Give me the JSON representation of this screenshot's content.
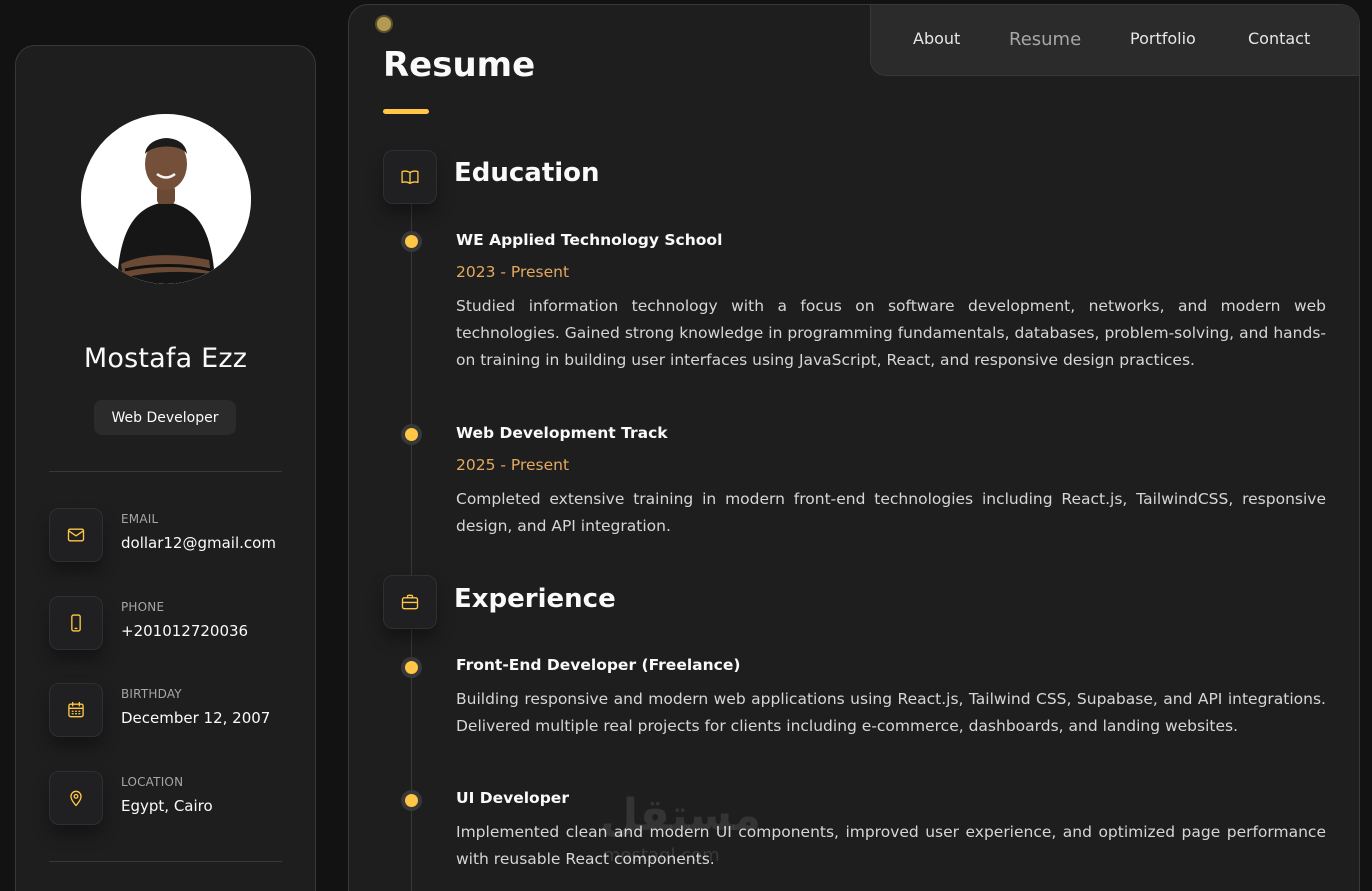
{
  "profile": {
    "name": "Mostafa Ezz",
    "role": "Web Developer"
  },
  "contacts": [
    {
      "label": "EMAIL",
      "value": "dollar12@gmail.com",
      "icon": "mail-icon"
    },
    {
      "label": "PHONE",
      "value": "+201012720036",
      "icon": "phone-icon"
    },
    {
      "label": "BIRTHDAY",
      "value": "December 12, 2007",
      "icon": "calendar-icon"
    },
    {
      "label": "LOCATION",
      "value": "Egypt, Cairo",
      "icon": "location-pin-icon"
    }
  ],
  "nav": {
    "items": [
      "About",
      "Resume",
      "Portfolio",
      "Contact"
    ],
    "active": "Resume"
  },
  "page": {
    "title": "Resume"
  },
  "education": {
    "title": "Education",
    "icon": "book-icon",
    "items": [
      {
        "title": "WE Applied Technology School",
        "date": "2023 - Present",
        "text": "Studied information technology with a focus on software development, networks, and modern web technologies. Gained strong knowledge in programming fundamentals, databases, problem-solving, and hands-on training in building user interfaces using JavaScript, React, and responsive design practices."
      },
      {
        "title": "Web Development Track",
        "date": "2025 - Present",
        "text": "Completed extensive training in modern front-end technologies including React.js, TailwindCSS, responsive design, and API integration."
      }
    ]
  },
  "experience": {
    "title": "Experience",
    "icon": "briefcase-icon",
    "items": [
      {
        "title": "Front-End Developer (Freelance)",
        "text": "Building responsive and modern web applications using React.js, Tailwind CSS, Supabase, and API integrations. Delivered multiple real projects for clients including e-commerce, dashboards, and landing websites."
      },
      {
        "title": "UI Developer",
        "text": "Implemented clean and modern UI components, improved user experience, and optimized page performance with reusable React components."
      }
    ]
  },
  "watermark": {
    "text": "مستقل",
    "sub": "mostaql.com"
  },
  "colors": {
    "accent": "#ffc745",
    "date": "#e3a960",
    "card": "#1e1e1f",
    "background": "#121212"
  }
}
